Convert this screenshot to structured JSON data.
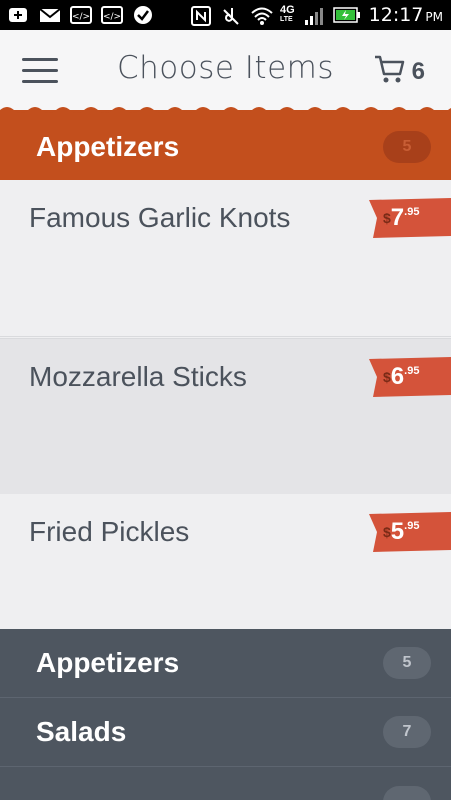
{
  "status_bar": {
    "time": "12:17",
    "ampm": "PM",
    "network_label": "4G",
    "network_sub": "LTE",
    "icons": [
      "add-icon",
      "gmail-icon",
      "code-icon",
      "code-icon",
      "check-icon",
      "nfc-icon",
      "mute-icon",
      "wifi-icon",
      "signal-icon",
      "battery-icon"
    ]
  },
  "header": {
    "title": "Choose Items",
    "cart_count": "6"
  },
  "current_category": {
    "title": "Appetizers",
    "count": "5"
  },
  "items": [
    {
      "name": "Famous Garlic Knots",
      "currency": "$",
      "price_main": "7",
      "price_cents": ".95"
    },
    {
      "name": "Mozzarella Sticks",
      "currency": "$",
      "price_main": "6",
      "price_cents": ".95"
    },
    {
      "name": "Fried Pickles",
      "currency": "$",
      "price_main": "5",
      "price_cents": ".95"
    }
  ],
  "categories": [
    {
      "title": "Appetizers",
      "count": "5"
    },
    {
      "title": "Salads",
      "count": "7"
    }
  ],
  "colors": {
    "accent": "#c34f1d",
    "price_tag": "#d4533a",
    "dark_panel": "#4e5660",
    "text": "#4b525c"
  }
}
